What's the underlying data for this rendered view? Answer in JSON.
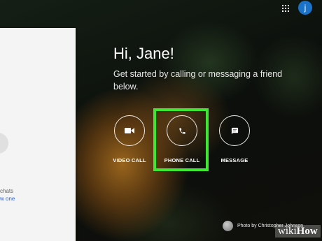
{
  "header": {
    "avatar_initial": "j"
  },
  "left_panel": {
    "chats_text": "chats",
    "link_text": "w one"
  },
  "main": {
    "greeting": "Hi, Jane!",
    "subtitle": "Get started by calling or messaging a friend below.",
    "actions": [
      {
        "label": "VIDEO CALL",
        "icon": "video-camera-icon"
      },
      {
        "label": "PHONE CALL",
        "icon": "phone-icon",
        "highlighted": true
      },
      {
        "label": "MESSAGE",
        "icon": "message-icon"
      }
    ]
  },
  "footer": {
    "photo_credit": "Photo by Christopher Johnson"
  },
  "watermark": {
    "prefix": "wiki",
    "suffix": "How"
  },
  "colors": {
    "highlight": "#3ee832",
    "avatar": "#1a73c8",
    "link": "#3367d6"
  }
}
